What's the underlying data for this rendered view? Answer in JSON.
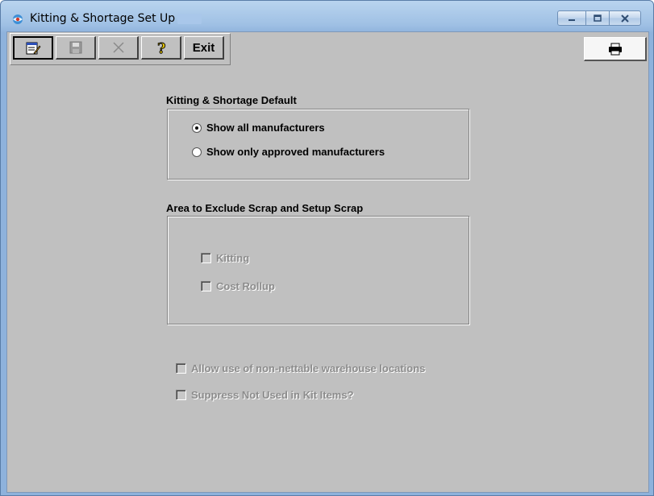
{
  "window": {
    "title": "Kitting & Shortage Set Up"
  },
  "toolbar": {
    "edit_icon": "edit-notepad-icon",
    "save_icon": "floppy-disk-icon",
    "cancel_icon": "x-cancel-icon",
    "help_icon": "question-mark-icon",
    "exit_label": "Exit",
    "print_icon": "printer-icon"
  },
  "kitting_default": {
    "label": "Kitting & Shortage Default",
    "options": [
      {
        "label": "Show all manufacturers",
        "selected": true
      },
      {
        "label": "Show only approved manufacturers",
        "selected": false
      }
    ]
  },
  "exclude_scrap": {
    "label": "Area to Exclude Scrap and Setup Scrap",
    "options": [
      {
        "label": "Kitting",
        "checked": false,
        "enabled": false
      },
      {
        "label": "Cost Rollup",
        "checked": false,
        "enabled": false
      }
    ]
  },
  "extra_options": [
    {
      "label": "Allow use of non-nettable warehouse locations",
      "checked": false,
      "enabled": false
    },
    {
      "label": "Suppress Not Used in Kit Items?",
      "checked": false,
      "enabled": false
    }
  ],
  "colors": {
    "face": "#c0c0c0",
    "title_gradient_top": "#b9d4ef",
    "frame": "#8eb2dc"
  }
}
